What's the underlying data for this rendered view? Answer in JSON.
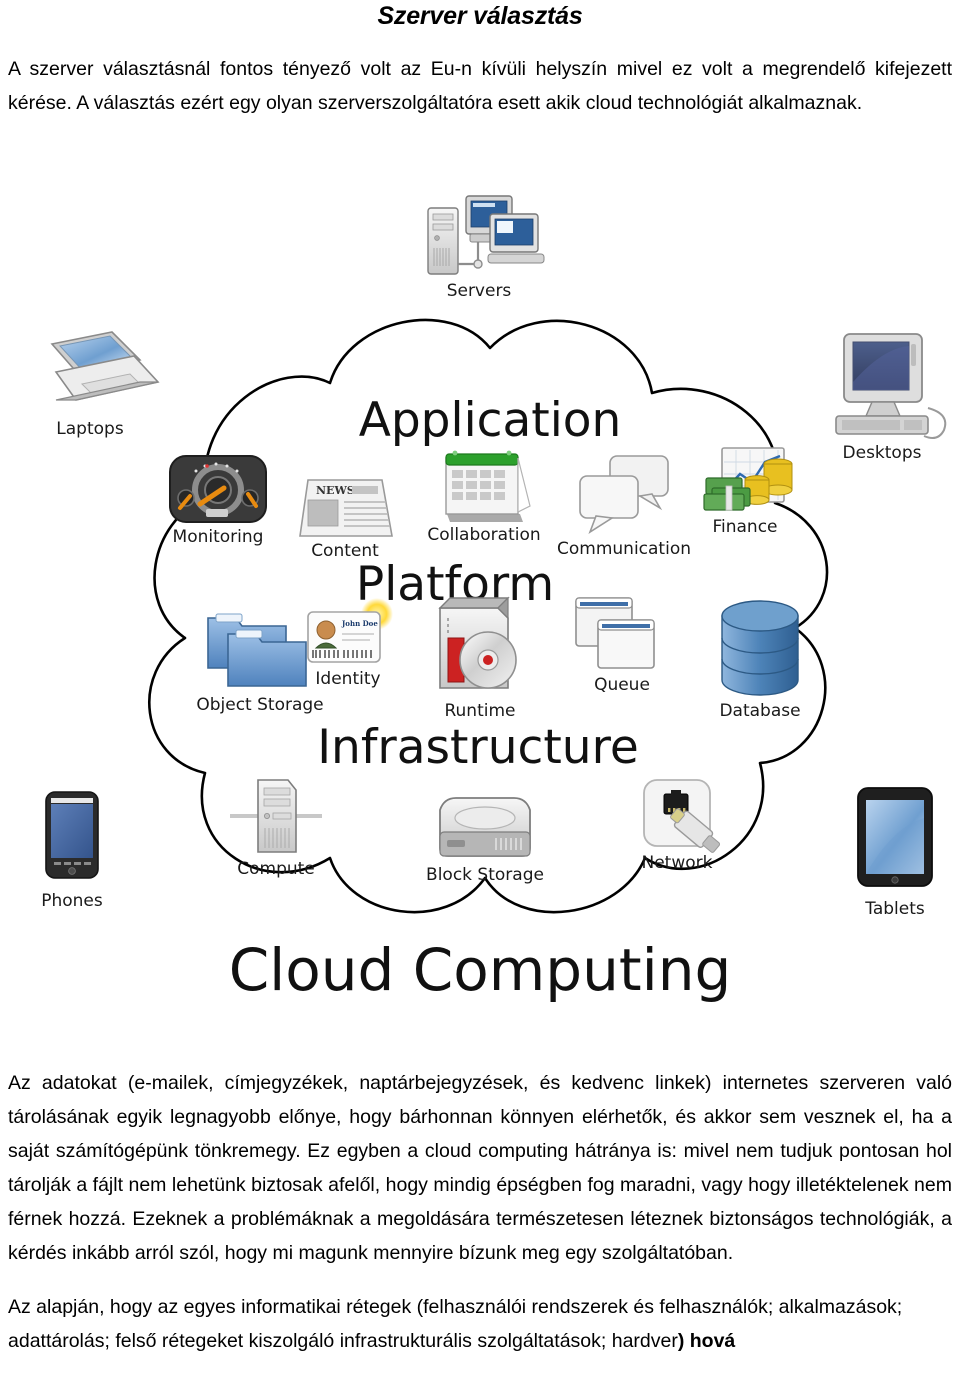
{
  "document": {
    "title": "Szerver választás",
    "paragraphs": {
      "intro": "A szerver választásnál fontos tényező volt az Eu-n  kívüli helyszín mivel ez volt a megrendelő kifejezett kérése. A választás ezért egy olyan szerverszolgáltatóra esett akik cloud technológiát alkalmaznak.",
      "body": "Az adatokat (e-mailek, címjegyzékek, naptárbejegyzések, és kedvenc linkek) internetes szerveren való tárolásának egyik legnagyobb előnye, hogy bárhonnan könnyen elérhetők, és akkor sem vesznek el, ha a saját számítógépünk tönkremegy. Ez egyben a cloud computing hátránya is: mivel nem tudjuk pontosan hol tárolják a fájlt nem lehetünk biztosak afelől, hogy mindig épségben fog maradni, vagy hogy illetéktelenek nem férnek hozzá. Ezeknek a problémáknak a megoldására természetesen léteznek biztonságos technológiák, a kérdés inkább arról szól, hogy mi magunk mennyire bízunk meg egy szolgáltatóban.",
      "closing_normal": "Az alapján, hogy az egyes informatikai rétegek (felhasználói rendszerek és felhasználók; alkalmazások; adattárolás; felső rétegeket kiszolgáló infrastrukturális szolgáltatások; hardver",
      "closing_bold": ") hová"
    }
  },
  "diagram": {
    "caption": "Cloud Computing",
    "layers": [
      {
        "name": "Application",
        "label": "Application"
      },
      {
        "name": "Platform",
        "label": "Platform"
      },
      {
        "name": "Infrastructure",
        "label": "Infrastructure"
      }
    ],
    "external_devices": [
      {
        "id": "servers",
        "label": "Servers",
        "icon": "servers-icon",
        "position": "top"
      },
      {
        "id": "laptops",
        "label": "Laptops",
        "icon": "laptop-icon",
        "position": "top-left"
      },
      {
        "id": "desktops",
        "label": "Desktops",
        "icon": "desktop-icon",
        "position": "top-right"
      },
      {
        "id": "phones",
        "label": "Phones",
        "icon": "phone-icon",
        "position": "bottom-left"
      },
      {
        "id": "tablets",
        "label": "Tablets",
        "icon": "tablet-icon",
        "position": "bottom-right"
      }
    ],
    "application_services": [
      {
        "id": "monitoring",
        "label": "Monitoring",
        "icon": "gauge-icon"
      },
      {
        "id": "content",
        "label": "Content",
        "icon": "newspaper-icon"
      },
      {
        "id": "collaboration",
        "label": "Collaboration",
        "icon": "calendar-icon"
      },
      {
        "id": "communication",
        "label": "Communication",
        "icon": "chat-bubbles-icon"
      },
      {
        "id": "finance",
        "label": "Finance",
        "icon": "money-chart-icon"
      }
    ],
    "platform_services": [
      {
        "id": "object-storage",
        "label": "Object Storage",
        "icon": "folders-icon"
      },
      {
        "id": "identity",
        "label": "Identity",
        "icon": "id-card-icon",
        "card_name": "John Doe"
      },
      {
        "id": "runtime",
        "label": "Runtime",
        "icon": "disc-drive-icon"
      },
      {
        "id": "queue",
        "label": "Queue",
        "icon": "windows-stack-icon"
      },
      {
        "id": "database",
        "label": "Database",
        "icon": "database-cylinder-icon"
      }
    ],
    "infrastructure_services": [
      {
        "id": "compute",
        "label": "Compute",
        "icon": "server-tower-icon"
      },
      {
        "id": "block-storage",
        "label": "Block Storage",
        "icon": "hard-disk-icon"
      },
      {
        "id": "network",
        "label": "Network",
        "icon": "ethernet-port-icon"
      }
    ],
    "colors": {
      "outline": "#000000",
      "folder_blue": "#5b8fc9",
      "database_blue": "#4a7fb5",
      "calendar_green": "#2ca02c",
      "money_green": "#4b9b43",
      "coin_gold": "#e8c020",
      "screen_blue": "#2d5f9a",
      "runtime_red": "#cc2222"
    }
  }
}
